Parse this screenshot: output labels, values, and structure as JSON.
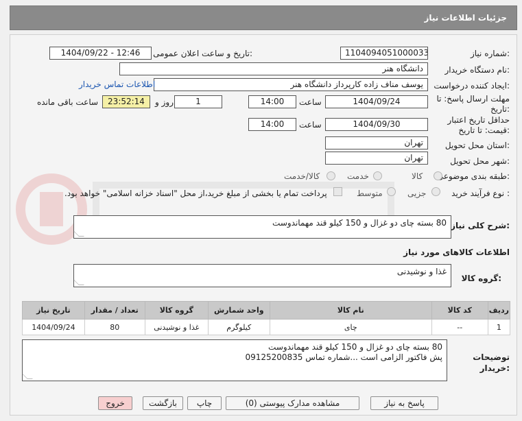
{
  "header": {
    "title": "جزئیات اطلاعات نیاز"
  },
  "fields": {
    "need_number_label": "شماره نیاز:",
    "need_number": "1104094051000033",
    "announce_label": "تاریخ و ساعت اعلان عمومی:",
    "announce_value": "1404/09/22 - 12:46",
    "buyer_org_label": "نام دستگاه خریدار:",
    "buyer_org": "دانشگاه هنر",
    "requester_label": "ایجاد کننده درخواست:",
    "requester": "یوسف مناف زاده کارپرداز دانشگاه هنر",
    "contact_link": "اطلاعات تماس خریدار",
    "deadline_label_1": "مهلت ارسال پاسخ: تا",
    "deadline_label_2": "تاریخ:",
    "deadline_date": "1404/09/24",
    "time_label": "ساعت",
    "deadline_time": "14:00",
    "days_value": "1",
    "days_label": "روز و",
    "remaining_time": "23:52:14",
    "remaining_label": "ساعت باقی مانده",
    "validity_label_1": "حداقل تاریخ اعتبار",
    "validity_label_2": "قیمت: تا تاریخ:",
    "validity_date": "1404/09/30",
    "validity_time": "14:00",
    "province_label": "استان محل تحویل:",
    "province": "تهران",
    "city_label": "شهر محل تحویل:",
    "city": "تهران",
    "category_label": "طبقه بندی موضوعی:",
    "category_options": [
      "کالا",
      "خدمت",
      "کالا/خدمت"
    ],
    "process_label": "نوع فرآیند خرید :",
    "process_options": [
      "جزیی",
      "متوسط"
    ],
    "payment_note": "پرداخت تمام یا بخشی از مبلغ خرید،از محل \"اسناد خزانه اسلامی\" خواهد بود.",
    "summary_label": "شرح کلی نیاز:",
    "summary": "80 بسته چای دو غزال  و 150 کیلو قند مهماندوست",
    "goods_info_label": "اطلاعات کالاهای مورد نیاز",
    "goods_group_label": "گروه کالا:",
    "goods_group": "غذا و نوشیدنی"
  },
  "table": {
    "headers": [
      "ردیف",
      "کد کالا",
      "نام کالا",
      "واحد شمارش",
      "گروه کالا",
      "تعداد / مقدار",
      "تاریخ نیاز"
    ],
    "rows": [
      [
        "1",
        "--",
        "چای",
        "کیلوگرم",
        "غذا و نوشیدنی",
        "80",
        "1404/09/24"
      ]
    ]
  },
  "buyer_notes": {
    "label_1": "توضیحات",
    "label_2": "خریدار:",
    "line_1": "80 بسته چای دو غزال و 150 کیلو قند مهماندوست",
    "line_2": "پش فاکتور الزامی است ...شماره تماس 09125200835"
  },
  "buttons": {
    "reply": "پاسخ به نیاز",
    "attachments": "مشاهده مدارک پیوستی (0)",
    "print": "چاپ",
    "back": "بازگشت",
    "exit": "خروج"
  },
  "colors": {
    "header_bg": "#8a8a8a",
    "highlight": "#f5f0a6",
    "exit_button": "#f7cfcf",
    "link": "#1a55b0"
  }
}
